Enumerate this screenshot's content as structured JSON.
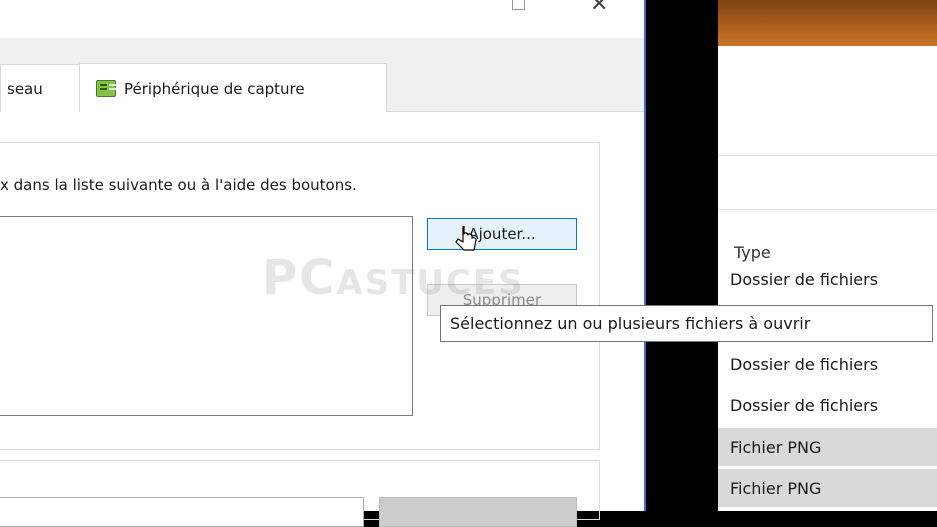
{
  "dialog": {
    "tabs": [
      {
        "label": "seau"
      },
      {
        "label": "Périphérique de capture",
        "icon": "capture-device-icon"
      }
    ],
    "instruction_text": "x dans la liste suivante ou à l'aide des boutons.",
    "add_button": "Ajouter...",
    "remove_button": "Supprimer",
    "accent_color": "#0078d7"
  },
  "tooltip": {
    "text": "Sélectionnez un ou plusieurs fichiers à ouvrir"
  },
  "explorer": {
    "column_header": "Type",
    "rows": [
      {
        "type": "Dossier de fichiers"
      },
      {
        "type": "Dossier de fichiers"
      },
      {
        "type": "Dossier de fichiers"
      },
      {
        "type": "Fichier PNG"
      },
      {
        "type": "Fichier PNG"
      }
    ]
  },
  "watermark": {
    "big": "PC",
    "small": "ASTUCES"
  }
}
